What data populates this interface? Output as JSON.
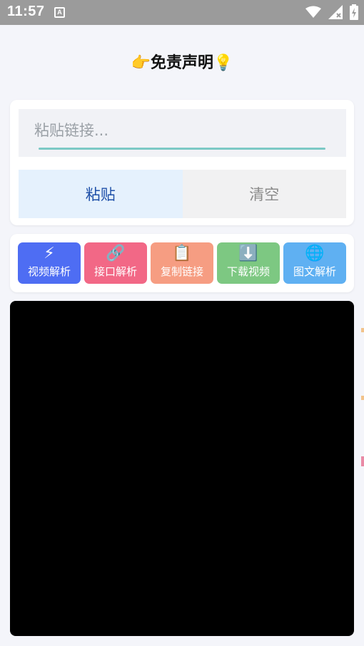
{
  "status_bar": {
    "time": "11:57",
    "app_icon_letter": "A"
  },
  "title": {
    "left_emoji": "👉",
    "text": "免责声明",
    "right_emoji": "💡"
  },
  "input": {
    "placeholder": "粘贴链接...",
    "value": ""
  },
  "buttons": {
    "paste": "粘贴",
    "clear": "清空"
  },
  "tools": [
    {
      "label": "视频解析",
      "icon": "⚡",
      "icon_name": "lightning-icon",
      "color": "#4e6df3"
    },
    {
      "label": "接口解析",
      "icon": "🔗",
      "icon_name": "link-icon",
      "color": "#f26886"
    },
    {
      "label": "复制链接",
      "icon": "📋",
      "icon_name": "clipboard-icon",
      "color": "#f69d82"
    },
    {
      "label": "下载视频",
      "icon": "⬇️",
      "icon_name": "download-icon",
      "color": "#7dc882"
    },
    {
      "label": "图文解析",
      "icon": "🌐",
      "icon_name": "globe-icon",
      "color": "#5fb0f2"
    }
  ],
  "colors": {
    "accent_underline": "#7cc9c5",
    "paste_bg": "#e5f1fd",
    "paste_text": "#1d4fa8"
  }
}
